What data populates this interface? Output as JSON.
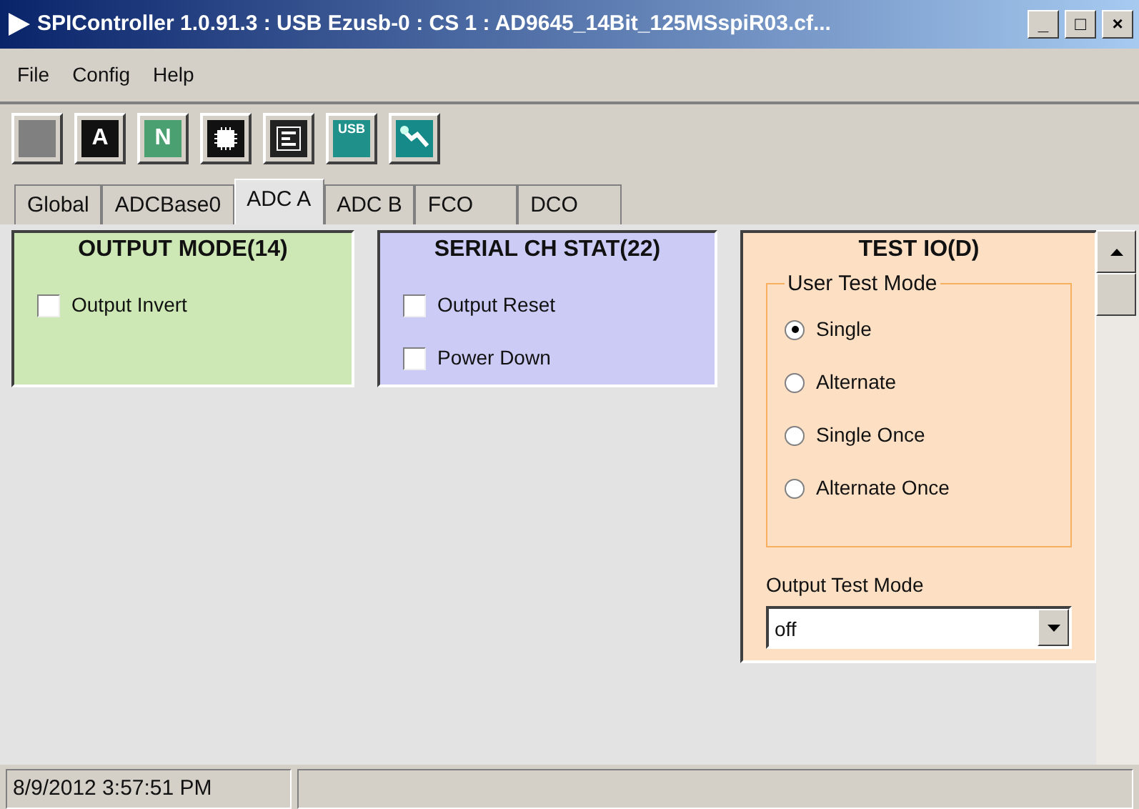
{
  "window": {
    "title": "SPIController 1.0.91.3 : USB Ezusb-0 : CS 1 : AD9645_14Bit_125MSspiR03.cf...",
    "controls": [
      "_",
      "□",
      "×"
    ]
  },
  "menu": [
    "File",
    "Config",
    "Help"
  ],
  "toolbar": [
    {
      "kind": "blank"
    },
    {
      "kind": "dark",
      "glyph": "A"
    },
    {
      "kind": "green",
      "glyph": "N"
    },
    {
      "kind": "chip"
    },
    {
      "kind": "form"
    },
    {
      "kind": "teal",
      "glyph": "USB"
    },
    {
      "kind": "graph"
    }
  ],
  "tabs": [
    {
      "label": "Global",
      "selected": false
    },
    {
      "label": "ADCBase0",
      "selected": false
    },
    {
      "label": "ADC A",
      "selected": true
    },
    {
      "label": "ADC B",
      "selected": false
    },
    {
      "label": "FCO",
      "selected": false
    },
    {
      "label": "DCO",
      "selected": false
    }
  ],
  "panels": [
    {
      "title": "OUTPUT MODE(14)",
      "color": "#cde8b4",
      "checkboxes": [
        {
          "label": "Output Invert",
          "checked": false
        }
      ]
    },
    {
      "title": "SERIAL CH STAT(22)",
      "color": "#cbcbf6",
      "checkboxes": [
        {
          "label": "Output Reset",
          "checked": false
        },
        {
          "label": "Power Down",
          "checked": false
        }
      ]
    },
    {
      "title": "TEST IO(D)",
      "color": "#fde0c4",
      "group": {
        "legend": "User Test Mode",
        "options": [
          {
            "label": "Single",
            "selected": true
          },
          {
            "label": "Alternate",
            "selected": false
          },
          {
            "label": "Single Once",
            "selected": false
          },
          {
            "label": "Alternate Once",
            "selected": false
          }
        ]
      },
      "select": {
        "label": "Output Test Mode",
        "value": "off"
      }
    }
  ],
  "status_bar": [
    "8/9/2012 3:57:51 PM"
  ]
}
